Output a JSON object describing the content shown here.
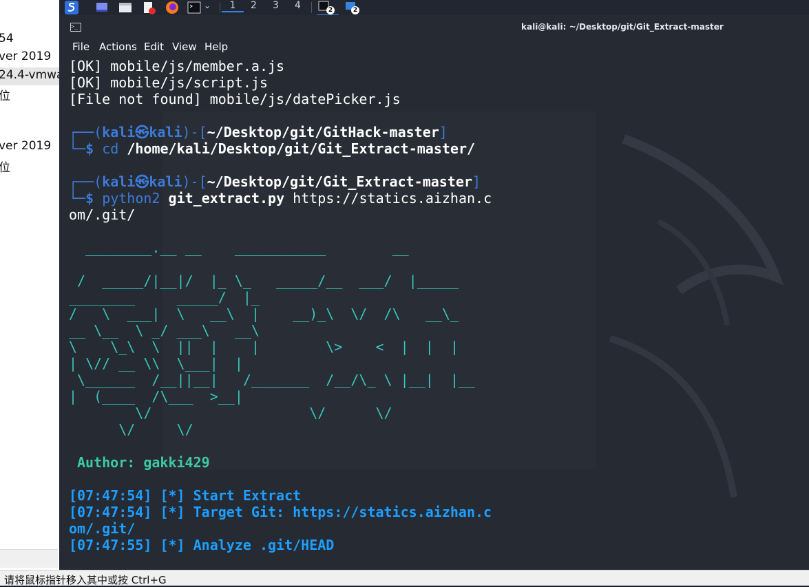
{
  "host": {
    "left_text": [
      "54",
      "ver 2019",
      "24.4-vmwa",
      "位",
      "ver 2019",
      "位"
    ],
    "status_bar": "请将鼠标指针移入其中或按 Ctrl+G"
  },
  "kali_panel": {
    "workspaces": [
      "1",
      "2",
      "3",
      "4"
    ],
    "badge_counts": [
      "2",
      "2"
    ]
  },
  "terminal": {
    "title": "kali@kali: ~/Desktop/git/Git_Extract-master",
    "menu": [
      "File",
      "Actions",
      "Edit",
      "View",
      "Help"
    ],
    "lines": {
      "ok1": "[OK] mobile/js/member.a.js",
      "ok2": "[OK] mobile/js/script.js",
      "notfound": "[File not found] mobile/js/datePicker.js",
      "p1_user": "kali㉿kali",
      "p1_path": "~/Desktop/git/GitHack-master",
      "p1_cmd": "cd",
      "p1_arg": "/home/kali/Desktop/git/Git_Extract-master/",
      "p2_user": "kali㉿kali",
      "p2_path": "~/Desktop/git/Git_Extract-master",
      "p2_exe": "python2",
      "p2_script": "git_extract.py",
      "p2_url1": "https://statics.aizhan.c",
      "p2_url2": "om/.git/",
      "author": "Author: gakki429",
      "log1": "[07:47:54] [*] Start Extract",
      "log2a": "[07:47:54] [*] Target Git: https://statics.aizhan.c",
      "log2b": "om/.git/",
      "log3": "[07:47:55] [*] Analyze .git/HEAD"
    },
    "ascii_art": [
      "  ________.__ __    ___________        __",
      " /  _____/|__|/  |_ \\_   _____/__  ___/  |_____",
      "________     _____/  |_",
      "/   \\  ___|  \\   __\\  |    __)_\\  \\/  /\\   __\\_",
      "__ \\__  \\ _/ ___\\   __\\",
      "\\    \\_\\  \\  ||  |    |        \\>    <  |  |  |",
      "| \\// __ \\\\  \\___|  |",
      " \\______  /__||__|   /_______  /__/\\_ \\ |__|  |__",
      "|  (____  /\\___  >__|",
      "        \\/                   \\/      \\/",
      "      \\/     \\/"
    ]
  }
}
